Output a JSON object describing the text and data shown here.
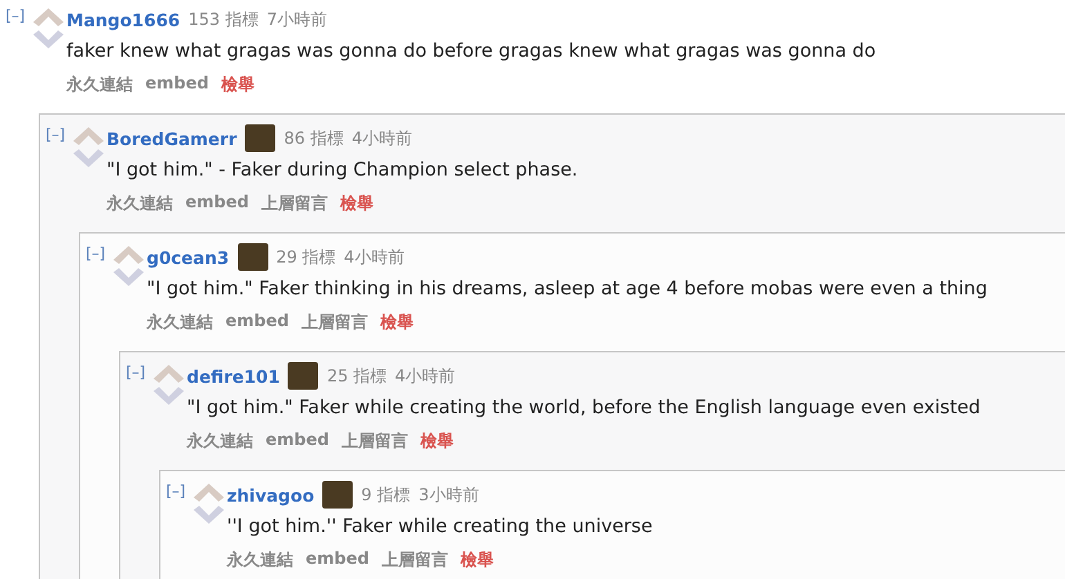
{
  "comments": [
    {
      "toggle": "[–]",
      "author": "Mango1666",
      "flair": false,
      "points": "153 指標",
      "time": "7小時前",
      "body": "faker knew what gragas was gonna do before gragas knew what gragas was gonna do",
      "actions": [
        {
          "label": "永久連結",
          "kind": "link"
        },
        {
          "label": "embed",
          "kind": "link"
        },
        {
          "label": "檢舉",
          "kind": "report"
        }
      ],
      "children": [
        {
          "toggle": "[–]",
          "author": "BoredGamerr",
          "flair": true,
          "points": "86 指標",
          "time": "4小時前",
          "body": "\"I got him.\" - Faker during Champion select phase.",
          "actions": [
            {
              "label": "永久連結",
              "kind": "link"
            },
            {
              "label": "embed",
              "kind": "link"
            },
            {
              "label": "上層留言",
              "kind": "link"
            },
            {
              "label": "檢舉",
              "kind": "report"
            }
          ],
          "children": [
            {
              "toggle": "[–]",
              "author": "g0cean3",
              "flair": true,
              "points": "29 指標",
              "time": "4小時前",
              "body": "\"I got him.\" Faker thinking in his dreams, asleep at age 4 before mobas were even a thing",
              "actions": [
                {
                  "label": "永久連結",
                  "kind": "link"
                },
                {
                  "label": "embed",
                  "kind": "link"
                },
                {
                  "label": "上層留言",
                  "kind": "link"
                },
                {
                  "label": "檢舉",
                  "kind": "report"
                }
              ],
              "children": [
                {
                  "toggle": "[–]",
                  "author": "defire101",
                  "flair": true,
                  "points": "25 指標",
                  "time": "4小時前",
                  "body": "\"I got him.\" Faker while creating the world, before the English language even existed",
                  "actions": [
                    {
                      "label": "永久連結",
                      "kind": "link"
                    },
                    {
                      "label": "embed",
                      "kind": "link"
                    },
                    {
                      "label": "上層留言",
                      "kind": "link"
                    },
                    {
                      "label": "檢舉",
                      "kind": "report"
                    }
                  ],
                  "children": [
                    {
                      "toggle": "[–]",
                      "author": "zhivagoo",
                      "flair": true,
                      "points": "9 指標",
                      "time": "3小時前",
                      "body": "''I got him.'' Faker while creating the universe",
                      "actions": [
                        {
                          "label": "永久連結",
                          "kind": "link"
                        },
                        {
                          "label": "embed",
                          "kind": "link"
                        },
                        {
                          "label": "上層留言",
                          "kind": "link"
                        },
                        {
                          "label": "檢舉",
                          "kind": "report"
                        }
                      ]
                    }
                  ]
                }
              ]
            }
          ]
        }
      ]
    }
  ]
}
